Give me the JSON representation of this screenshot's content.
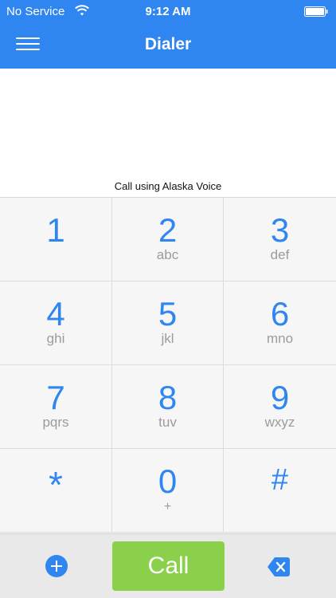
{
  "status_bar": {
    "carrier": "No Service",
    "time": "9:12 AM"
  },
  "header": {
    "title": "Dialer"
  },
  "call_using": "Call using Alaska Voice",
  "keys": [
    {
      "digit": "1",
      "letters": ""
    },
    {
      "digit": "2",
      "letters": "abc"
    },
    {
      "digit": "3",
      "letters": "def"
    },
    {
      "digit": "4",
      "letters": "ghi"
    },
    {
      "digit": "5",
      "letters": "jkl"
    },
    {
      "digit": "6",
      "letters": "mno"
    },
    {
      "digit": "7",
      "letters": "pqrs"
    },
    {
      "digit": "8",
      "letters": "tuv"
    },
    {
      "digit": "9",
      "letters": "wxyz"
    },
    {
      "digit": "*",
      "letters": ""
    },
    {
      "digit": "0",
      "letters": "+"
    },
    {
      "digit": "#",
      "letters": ""
    }
  ],
  "bottom_bar": {
    "call_label": "Call"
  },
  "colors": {
    "accent": "#2f86f0",
    "call_green": "#8ad04a",
    "header_bg": "#2f86f0"
  },
  "icons": {
    "menu": "hamburger-menu-icon",
    "wifi": "wifi-icon",
    "battery": "battery-icon",
    "add": "add-circle-icon",
    "backspace": "backspace-icon"
  }
}
